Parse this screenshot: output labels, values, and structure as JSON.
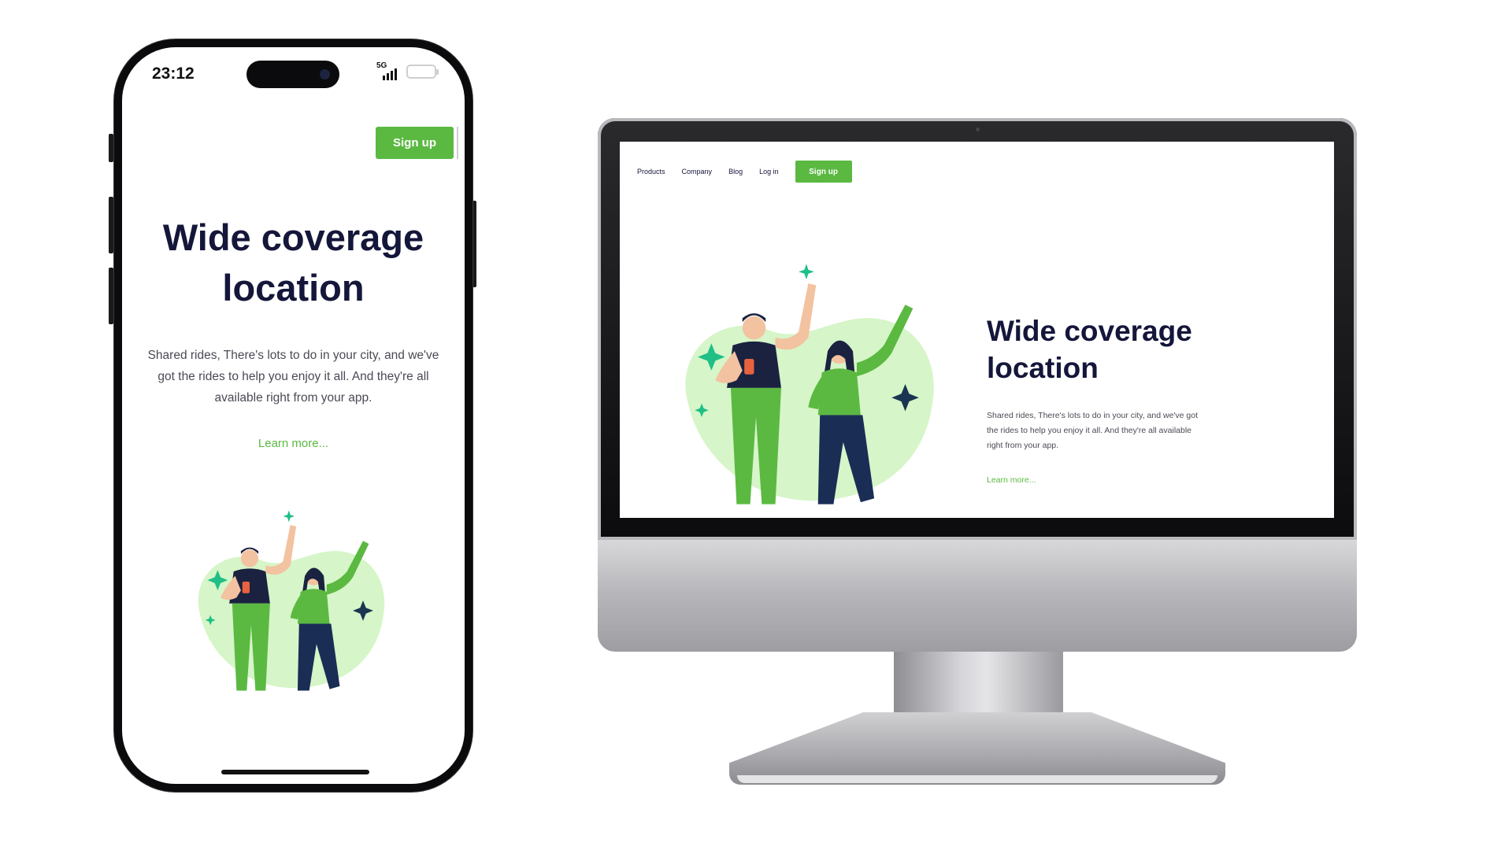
{
  "mobile": {
    "status_time": "23:12",
    "network": "5G",
    "signup_label": "Sign up",
    "hero_title": "Wide coverage location",
    "hero_body": "Shared rides, There's lots to do in your city, and we've got the rides to help you enjoy it all. And they're all available right from your app.",
    "learn_more": "Learn more..."
  },
  "desktop": {
    "nav": [
      "Products",
      "Company",
      "Blog",
      "Log in"
    ],
    "signup_label": "Sign up",
    "hero_title": "Wide coverage location",
    "hero_body": "Shared rides, There's lots to do in your city, and we've got the rides to help you enjoy it all. And they're all available right from your app.",
    "learn_more": "Learn more..."
  },
  "colors": {
    "brand_green": "#5bb942",
    "heading_navy": "#14163a",
    "blob_green": "#d6f5c8",
    "sparkle_teal": "#1fbf86"
  },
  "icons": [
    "signal-icon",
    "battery-icon",
    "camera-icon"
  ]
}
